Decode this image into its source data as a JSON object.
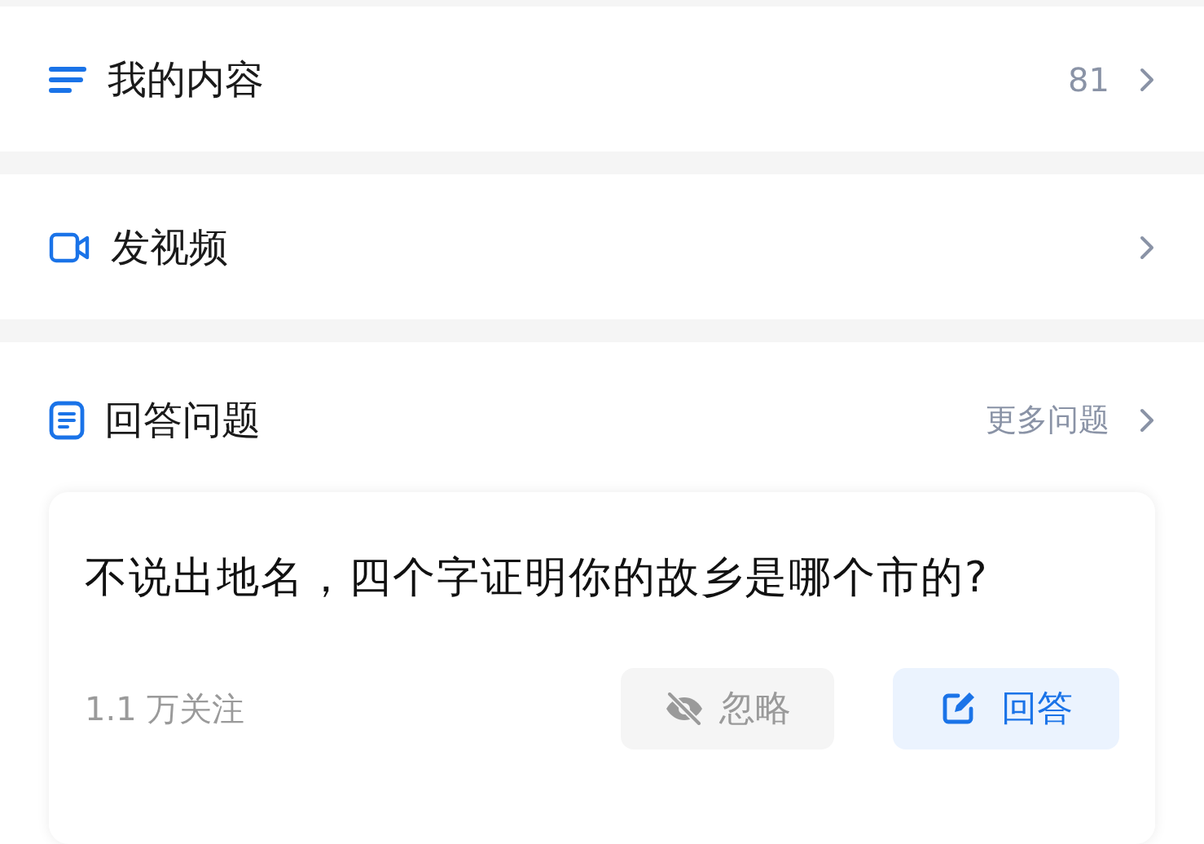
{
  "menu_items": [
    {
      "label": "我的内容",
      "count": "81"
    },
    {
      "label": "发视频"
    }
  ],
  "answer_section": {
    "title": "回答问题",
    "more": "更多问题",
    "question": {
      "text": "不说出地名，四个字证明你的故乡是哪个市的?",
      "followers": "1.1 万关注",
      "buttons": [
        {
          "kind": "ignore",
          "label": "忽略"
        },
        {
          "kind": "answer",
          "label": "回答"
        }
      ]
    }
  }
}
